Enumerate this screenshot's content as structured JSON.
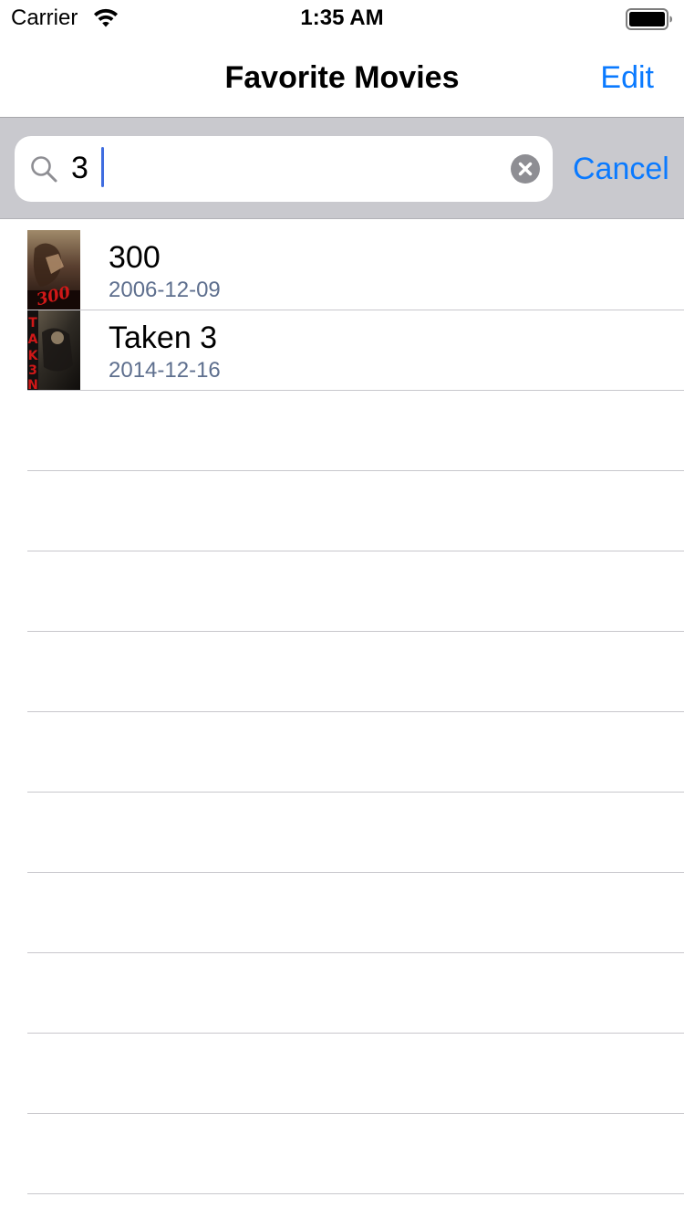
{
  "status_bar": {
    "carrier": "Carrier",
    "time": "1:35 AM"
  },
  "nav": {
    "title": "Favorite Movies",
    "edit_label": "Edit"
  },
  "search": {
    "value": "3",
    "cancel_label": "Cancel"
  },
  "movies": [
    {
      "title": "300",
      "date": "2006-12-09",
      "poster_text": "300"
    },
    {
      "title": "Taken 3",
      "date": "2014-12-16",
      "poster_text": "TAK3N"
    }
  ],
  "colors": {
    "accent": "#0a7aff",
    "search_background": "#c9c9ce",
    "subtitle": "#5e6f8e",
    "separator": "#c8c7cc",
    "caret": "#3f6de0"
  }
}
